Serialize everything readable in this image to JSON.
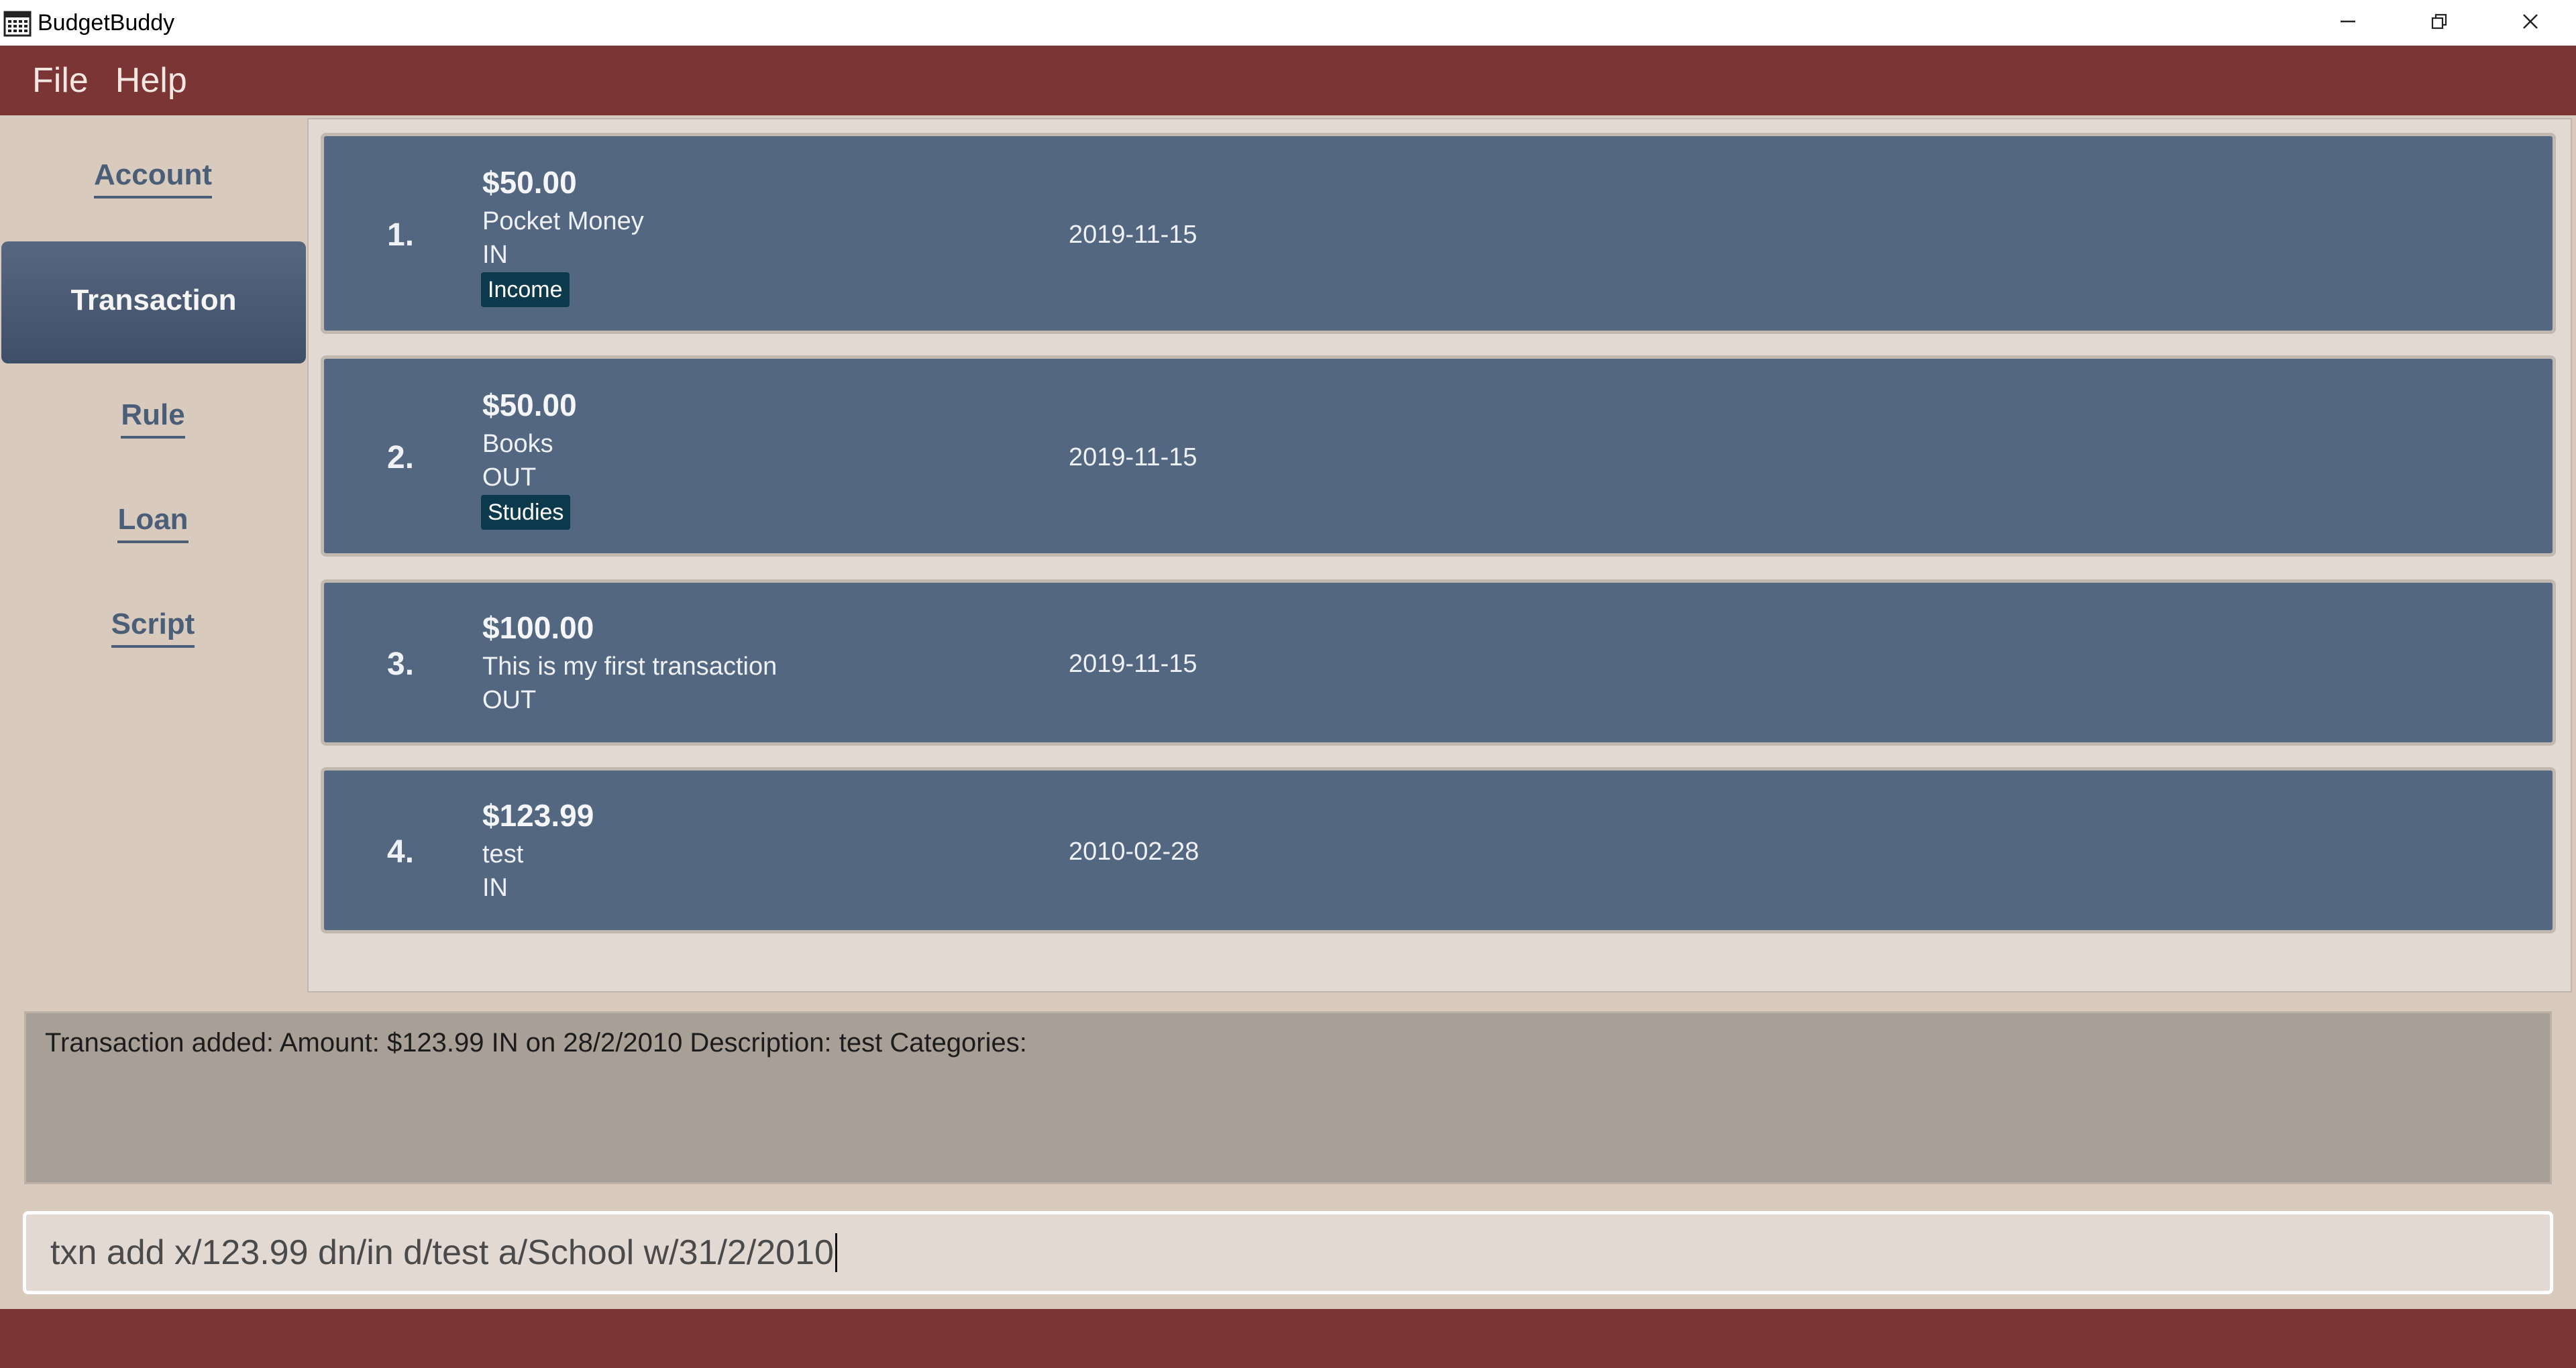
{
  "window": {
    "title": "BudgetBuddy",
    "icons": {
      "app": "calendar-icon",
      "minimize": "minimize-icon",
      "restore": "restore-icon",
      "close": "close-icon"
    }
  },
  "menu": {
    "file": "File",
    "help": "Help"
  },
  "sidebar": {
    "items": [
      {
        "label": "Account"
      },
      {
        "label": "Transaction",
        "active": true
      },
      {
        "label": "Rule"
      },
      {
        "label": "Loan"
      },
      {
        "label": "Script"
      }
    ]
  },
  "transactions": [
    {
      "index": "1.",
      "amount": "$50.00",
      "description": "Pocket Money",
      "direction": "IN",
      "date": "2019-11-15",
      "tag": "Income"
    },
    {
      "index": "2.",
      "amount": "$50.00",
      "description": "Books",
      "direction": "OUT",
      "date": "2019-11-15",
      "tag": "Studies"
    },
    {
      "index": "3.",
      "amount": "$100.00",
      "description": "This is my first transaction",
      "direction": "OUT",
      "date": "2019-11-15"
    },
    {
      "index": "4.",
      "amount": "$123.99",
      "description": "test",
      "direction": "IN",
      "date": "2010-02-28"
    }
  ],
  "result": {
    "text": "Transaction added: Amount: $123.99 IN on 28/2/2010 Description: test Categories:"
  },
  "command": {
    "value": "txn add x/123.99 dn/in d/test a/School w/31/2/2010"
  },
  "colors": {
    "menubar": "#7b3534",
    "card": "#536781",
    "tag": "#0c3a4c",
    "nav_active": "#4a5e78"
  }
}
